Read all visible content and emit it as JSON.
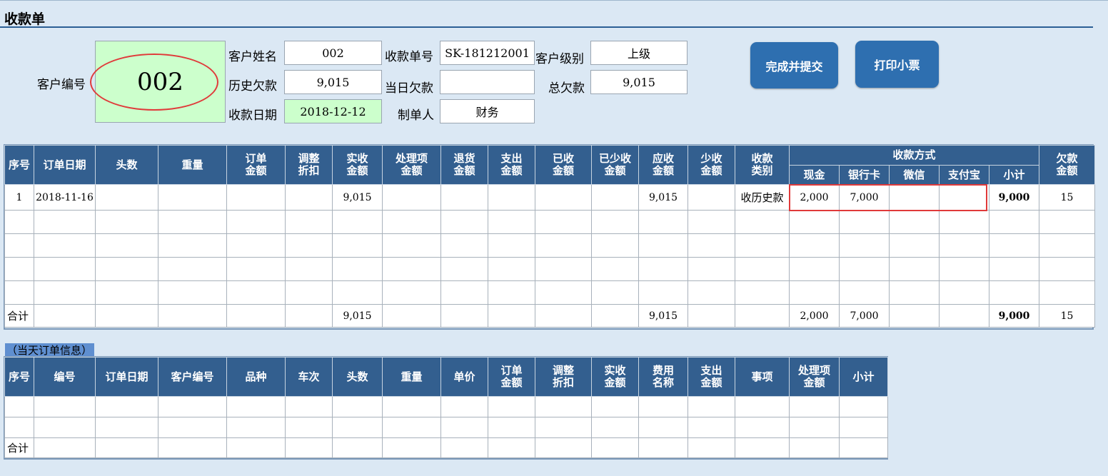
{
  "title": "收款单",
  "header": {
    "customer_id_label": "客户编号",
    "customer_id": "002",
    "name_label": "客户姓名",
    "name": "002",
    "receipt_no_label": "收款单号",
    "receipt_no": "SK-181212001",
    "level_label": "客户级别",
    "level": "上级",
    "history_debt_label": "历史欠款",
    "history_debt": "9,015",
    "day_debt_label": "当日欠款",
    "day_debt": "",
    "total_debt_label": "总欠款",
    "total_debt": "9,015",
    "date_label": "收款日期",
    "date": "2018-12-12",
    "maker_label": "制单人",
    "maker": "财务"
  },
  "buttons": {
    "submit": "完成并提交",
    "print": "打印小票"
  },
  "main_table": {
    "headers": {
      "seq": "序号",
      "order_date": "订单日期",
      "heads": "头数",
      "weight": "重量",
      "order_amount": [
        "订单",
        "金额"
      ],
      "adjust": [
        "调整",
        "折扣"
      ],
      "actual": [
        "实收",
        "金额"
      ],
      "handle": [
        "处理项",
        "金额"
      ],
      "return": [
        "退货",
        "金额"
      ],
      "expense": [
        "支出",
        "金额"
      ],
      "received": [
        "已收",
        "金额"
      ],
      "short_received": [
        "已少收",
        "金额"
      ],
      "receivable": [
        "应收",
        "金额"
      ],
      "short": [
        "少收",
        "金额"
      ],
      "category": [
        "收款",
        "类别"
      ],
      "payment_method": "收款方式",
      "cash": "现金",
      "bank": "银行卡",
      "wechat": "微信",
      "alipay": "支付宝",
      "subtotal": "小计",
      "owed": [
        "欠款",
        "金额"
      ]
    },
    "rows": [
      [
        "1",
        "2018-11-16",
        "",
        "",
        "",
        "",
        "9,015",
        "",
        "",
        "",
        "",
        "",
        "9,015",
        "",
        "收历史款",
        "2,000",
        "7,000",
        "",
        "",
        "9,000",
        "15"
      ],
      [
        "",
        "",
        "",
        "",
        "",
        "",
        "",
        "",
        "",
        "",
        "",
        "",
        "",
        "",
        "",
        "",
        "",
        "",
        "",
        "",
        ""
      ],
      [
        "",
        "",
        "",
        "",
        "",
        "",
        "",
        "",
        "",
        "",
        "",
        "",
        "",
        "",
        "",
        "",
        "",
        "",
        "",
        "",
        ""
      ],
      [
        "",
        "",
        "",
        "",
        "",
        "",
        "",
        "",
        "",
        "",
        "",
        "",
        "",
        "",
        "",
        "",
        "",
        "",
        "",
        "",
        ""
      ],
      [
        "",
        "",
        "",
        "",
        "",
        "",
        "",
        "",
        "",
        "",
        "",
        "",
        "",
        "",
        "",
        "",
        "",
        "",
        "",
        "",
        ""
      ]
    ],
    "total_row": [
      "合计",
      "",
      "",
      "",
      "",
      "",
      "9,015",
      "",
      "",
      "",
      "",
      "",
      "9,015",
      "",
      "",
      "2,000",
      "7,000",
      "",
      "",
      "9,000",
      "15"
    ]
  },
  "day_section": {
    "tag": "（当天订单信息）",
    "headers": [
      "序号",
      "编号",
      "订单日期",
      "客户编号",
      "品种",
      "车次",
      "头数",
      "重量",
      "单价",
      [
        "订单",
        "金额"
      ],
      [
        "调整",
        "折扣"
      ],
      [
        "实收",
        "金额"
      ],
      [
        "费用",
        "名称"
      ],
      [
        "支出",
        "金额"
      ],
      "事项",
      [
        "处理项",
        "金额"
      ],
      "小计"
    ],
    "rows": [
      [
        "",
        "",
        "",
        "",
        "",
        "",
        "",
        "",
        "",
        "",
        "",
        "",
        "",
        "",
        "",
        "",
        ""
      ],
      [
        "",
        "",
        "",
        "",
        "",
        "",
        "",
        "",
        "",
        "",
        "",
        "",
        "",
        "",
        "",
        "",
        ""
      ]
    ],
    "total_label": "合计"
  },
  "colors": {
    "header_blue": "#335f8f",
    "button_blue": "#2e6fb0",
    "highlight_green": "#ccffcc",
    "annotation_red": "#e03a3a",
    "background": "#dbe8f4"
  }
}
